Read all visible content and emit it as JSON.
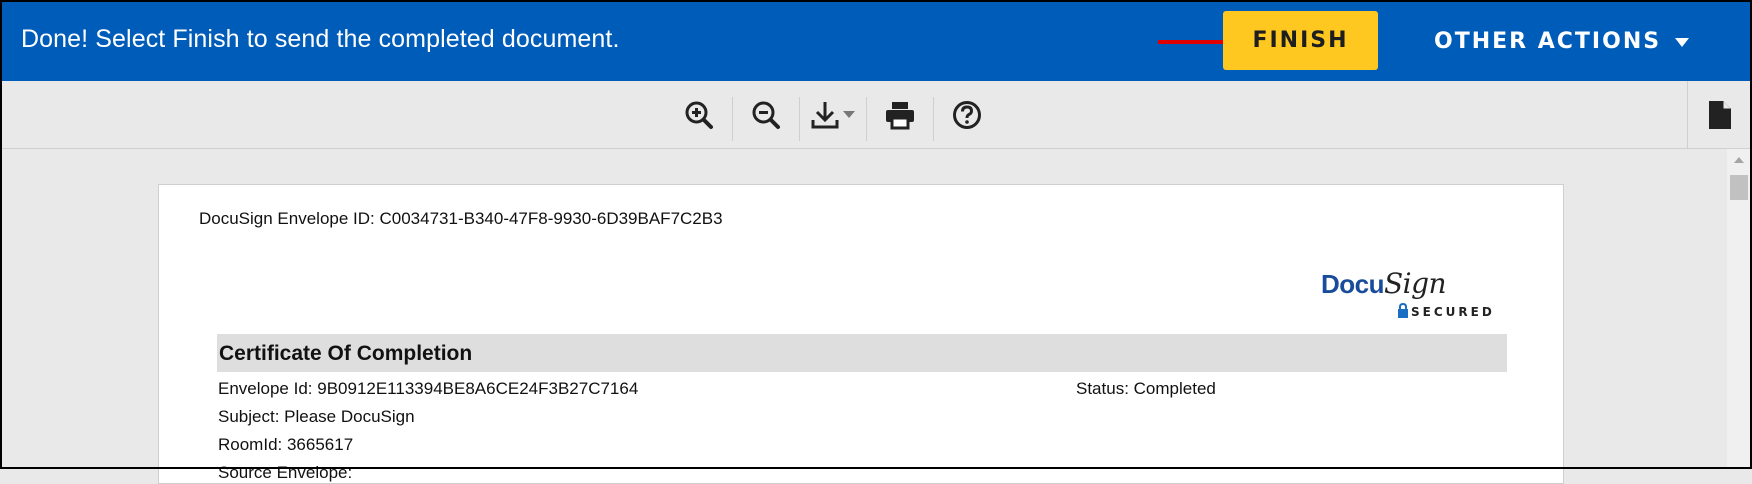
{
  "banner": {
    "message": "Done! Select Finish to send the completed document.",
    "finish_label": "FINISH",
    "other_actions_label": "OTHER ACTIONS"
  },
  "toolbar": {
    "icons": [
      "zoom-in-icon",
      "zoom-out-icon",
      "download-icon",
      "print-icon",
      "help-icon",
      "document-icon"
    ]
  },
  "document": {
    "envelope_id_line": "DocuSign Envelope ID: C0034731-B340-47F8-9930-6D39BAF7C2B3",
    "logo": {
      "brand_part1": "Docu",
      "brand_part2": "Sign",
      "secured": "SECURED"
    },
    "certificate_title": "Certificate Of Completion",
    "fields": {
      "envelope_id": "Envelope Id: 9B0912E113394BE8A6CE24F3B27C7164",
      "status": "Status: Completed",
      "subject": "Subject: Please DocuSign",
      "room_id": "RoomId: 3665617",
      "partial_line": "Source Envelope:"
    }
  },
  "colors": {
    "banner_blue": "#005cb9",
    "finish_yellow": "#ffc820",
    "arrow_red": "#e00000",
    "logo_blue": "#1a4c9c"
  }
}
